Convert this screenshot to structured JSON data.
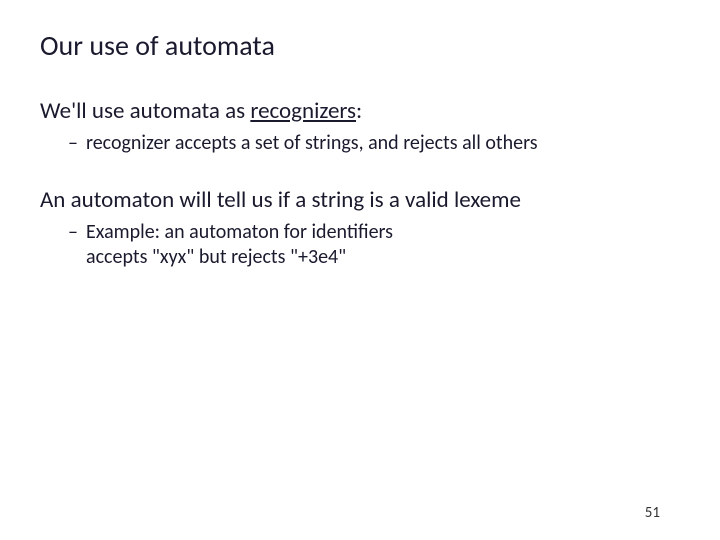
{
  "title": "Our use of automata",
  "line1_pre": "We'll use automata as ",
  "line1_underlined": "recognizers",
  "line1_post": ":",
  "bullet1": "recognizer accepts a set of strings, and rejects all others",
  "line2": "An automaton will tell us if a string is a valid lexeme",
  "bullet2a": "Example: an automaton for identifiers",
  "bullet2b": "accepts \"xyx\" but rejects \"+3e4\"",
  "page_number": "51"
}
